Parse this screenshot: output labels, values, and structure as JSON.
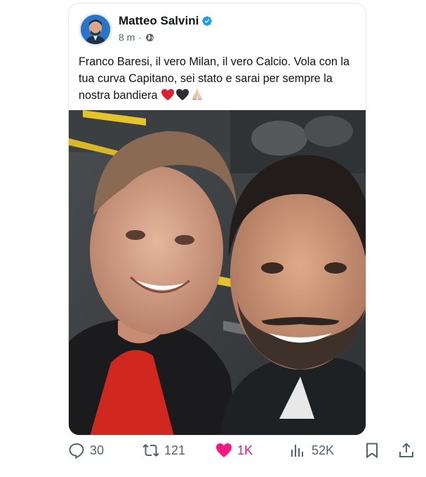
{
  "post": {
    "author_name": "Matteo Salvini",
    "time": "8 m",
    "separator": "·",
    "verified_icon": "verified-badge-icon",
    "visibility_icon": "globe-icon",
    "text": "Franco Baresi, il vero Milan, il vero Calcio. Vola con la tua curva Capitano, sei stato e sarai per sempre la nostra bandiera",
    "emojis": [
      "red-heart",
      "black-heart",
      "folded-hands"
    ],
    "photo_description": "selfie-two-men-stadium"
  },
  "actions": {
    "replies": "30",
    "reposts": "121",
    "likes": "1K",
    "views": "52K"
  },
  "colors": {
    "accent": "#1d9bf0",
    "like": "#f91880",
    "muted": "#536471",
    "text": "#0f1419"
  }
}
